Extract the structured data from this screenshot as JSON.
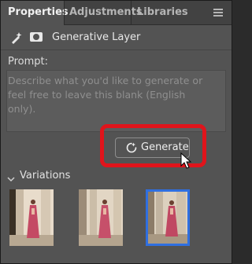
{
  "tabs": [
    {
      "label": "Properties",
      "active": true
    },
    {
      "label": "Adjustments",
      "active": false
    },
    {
      "label": "Libraries",
      "active": false
    }
  ],
  "layer": {
    "title": "Generative Layer",
    "icons": [
      "generative-layer-icon",
      "mask-icon"
    ]
  },
  "prompt": {
    "label": "Prompt:",
    "value": "",
    "placeholder": "Describe what you'd like to generate or feel free to leave this blank (English only)."
  },
  "generate_button": {
    "label": "Generate",
    "icon": "generate-icon"
  },
  "highlight_color": "#e0141b",
  "variations": {
    "label": "Variations",
    "items": [
      {
        "selected": false
      },
      {
        "selected": false
      },
      {
        "selected": true
      }
    ],
    "selected_color": "#2f6fe0"
  }
}
